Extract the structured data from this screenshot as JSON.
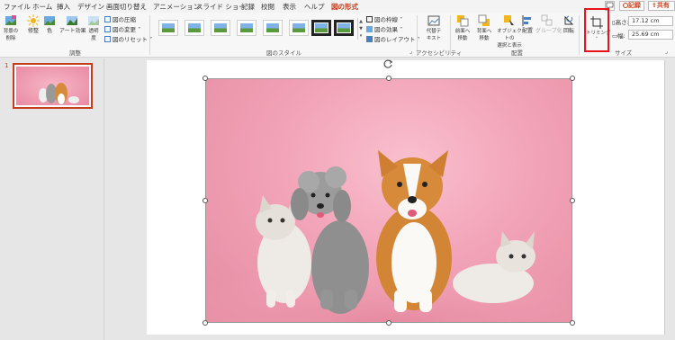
{
  "tabs": [
    "ファイル",
    "ホーム",
    "挿入",
    "デザイン",
    "画面切り替え",
    "アニメーション",
    "スライド ショー",
    "記録",
    "校閲",
    "表示",
    "ヘルプ",
    "図の形式"
  ],
  "active_tab": "図の形式",
  "top_right": {
    "record": "記録",
    "share": "共有"
  },
  "ribbon": {
    "adjust": {
      "remove_bg": "背景の\n削除",
      "corrections": "修整",
      "color": "色",
      "artistic": "アート効果",
      "transparency": "透明\n度",
      "compress": "図の圧縮",
      "change": "図の変更",
      "reset": "図のリセット",
      "label": "調整"
    },
    "styles": {
      "border": "図の枠線",
      "effects": "図の効果",
      "layout": "図のレイアウト",
      "label": "図のスタイル"
    },
    "accessibility": {
      "alt_text": "代替テ\nキスト",
      "label": "アクセシビリティ"
    },
    "arrange": {
      "bring_forward": "前面へ\n移動",
      "send_backward": "背面へ\n移動",
      "selection_pane": "オブジェクトの\n選択と表示",
      "align": "配置",
      "group": "グループ化",
      "rotate": "回転",
      "label": "配置"
    },
    "size": {
      "crop": "トリミング",
      "height_label": "高さ:",
      "height_value": "17.12 cm",
      "width_label": "幅:",
      "width_value": "25.69 cm",
      "label": "サイズ"
    }
  },
  "slide_panel": {
    "slide_number": "1"
  },
  "colors": {
    "accent": "#c43e1c",
    "highlight": "#e8131c",
    "photo_bg": "#f2a3b7"
  }
}
